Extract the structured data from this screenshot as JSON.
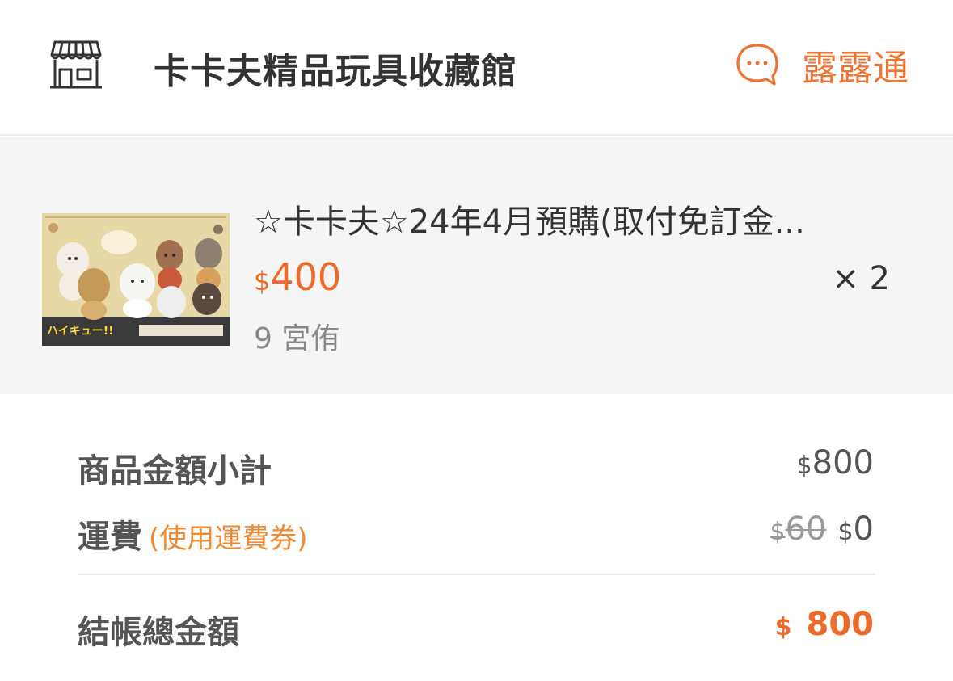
{
  "shop": {
    "name": "卡卡夫精品玩具收藏館",
    "store_icon": "storefront-icon",
    "chat_icon": "chat-bubble-icon",
    "chat_label": "露露通"
  },
  "product": {
    "title": "☆卡卡夫☆24年4月預購(取付免訂金...",
    "price_currency": "$",
    "price_value": "400",
    "quantity": "× 2",
    "variant": "9 宮侑",
    "thumbnail_text": "ハイキュー!!"
  },
  "summary": {
    "subtotal_label": "商品金額小計",
    "subtotal_currency": "$",
    "subtotal_value": "800",
    "shipping_label": "運費",
    "shipping_note": "(使用運費券)",
    "shipping_original_currency": "$",
    "shipping_original": "60",
    "shipping_currency": "$",
    "shipping_value": "0",
    "total_label": "結帳總金額",
    "total_currency": "$",
    "total_value": "800"
  },
  "colors": {
    "accent": "#ee6a2a",
    "note": "#ee8a33",
    "product_bg": "#f5f5f5"
  }
}
